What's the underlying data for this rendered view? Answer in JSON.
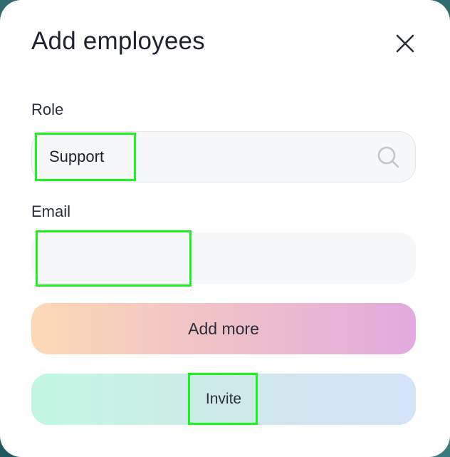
{
  "modal": {
    "title": "Add employees",
    "close_icon": "close-icon"
  },
  "role": {
    "label": "Role",
    "value": "Support",
    "icon": "search-icon"
  },
  "email": {
    "label": "Email",
    "value": ""
  },
  "buttons": {
    "add_more": "Add more",
    "invite": "Invite"
  },
  "colors": {
    "highlight": "#1ef21e",
    "add_more_gradient": [
      "#fdd9b5",
      "#f0c3c6",
      "#e2a9de"
    ],
    "invite_gradient": [
      "#c3f7e3",
      "#cdeae8",
      "#d5e3f9"
    ],
    "field_bg": "#f6f7f9"
  }
}
